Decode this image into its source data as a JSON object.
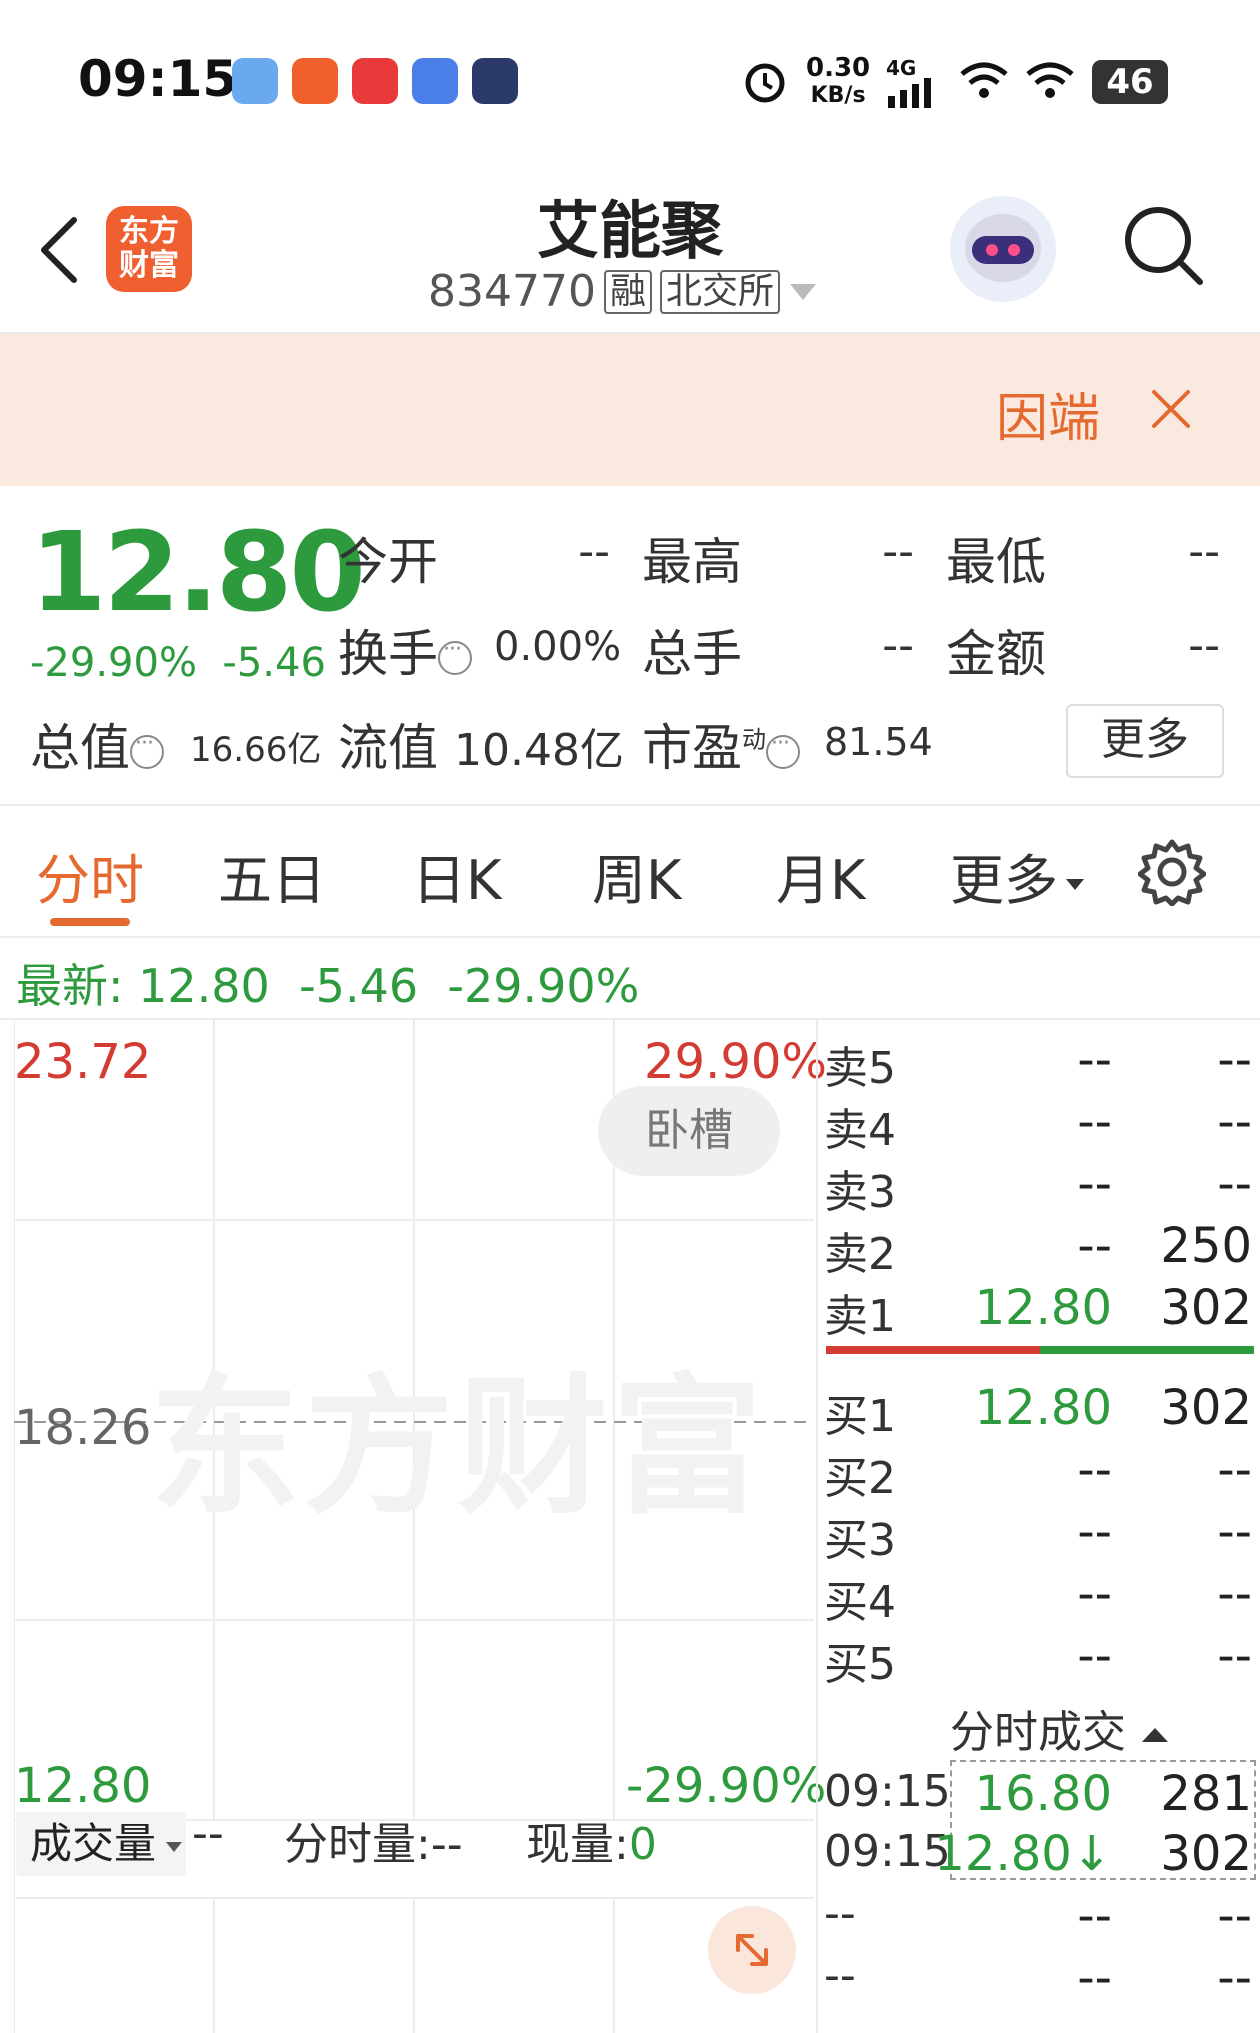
{
  "status_bar": {
    "time": "09:15",
    "net_speed_value": "0.30",
    "net_speed_unit": "KB/s",
    "network_type": "4G",
    "battery": "46",
    "icons": [
      "notes-app-icon",
      "flight-app-icon",
      "music-app-icon",
      "browser-app-icon",
      "video-app-icon",
      "alarm-icon",
      "signal-icon",
      "wifi-plus-icon",
      "wifi-icon",
      "battery-icon"
    ]
  },
  "header": {
    "brand_line1": "东方",
    "brand_line2": "财富",
    "stock_name": "艾能聚",
    "stock_code": "834770",
    "tag_margin": "融",
    "tag_exchange": "北交所"
  },
  "banner": {
    "text": "因端"
  },
  "quote": {
    "price": "12.80",
    "change_pct": "-29.90%",
    "change_amt": "-5.46",
    "open_label": "今开",
    "open_val": "--",
    "high_label": "最高",
    "high_val": "--",
    "low_label": "最低",
    "low_val": "--",
    "turnover_label": "换手",
    "turnover_val": "0.00%",
    "total_lots_label": "总手",
    "total_lots_val": "--",
    "amount_label": "金额",
    "amount_val": "--",
    "market_cap_label": "总值",
    "market_cap_val": "16.66亿",
    "float_cap_label": "流值",
    "float_cap_val": "10.48亿",
    "pe_label": "市盈",
    "pe_superscript": "动",
    "pe_val": "81.54",
    "more_label": "更多"
  },
  "tabs": [
    {
      "label": "分时",
      "active": true
    },
    {
      "label": "五日"
    },
    {
      "label": "日K"
    },
    {
      "label": "周K"
    },
    {
      "label": "月K"
    },
    {
      "label": "更多"
    }
  ],
  "latest": {
    "label": "最新:",
    "price": "12.80",
    "change": "-5.46",
    "pct": "-29.90%"
  },
  "chart": {
    "upper_price": "23.72",
    "upper_pct": "29.90%",
    "mid_price": "18.26",
    "lower_price": "12.80",
    "lower_pct": "-29.90%",
    "lying_label": "卧槽",
    "watermark": "东方财富"
  },
  "volume_bar": {
    "selector_label": "成交量",
    "selector_value": "--",
    "period_vol": "分时量:--",
    "current_vol_label": "现量:",
    "current_vol_value": "0"
  },
  "order_book": {
    "asks": [
      {
        "label": "卖5",
        "price": "--",
        "volume": "--"
      },
      {
        "label": "卖4",
        "price": "--",
        "volume": "--"
      },
      {
        "label": "卖3",
        "price": "--",
        "volume": "--"
      },
      {
        "label": "卖2",
        "price": "--",
        "volume": "250"
      },
      {
        "label": "卖1",
        "price": "12.80",
        "volume": "302"
      }
    ],
    "bids": [
      {
        "label": "买1",
        "price": "12.80",
        "volume": "302"
      },
      {
        "label": "买2",
        "price": "--",
        "volume": "--"
      },
      {
        "label": "买3",
        "price": "--",
        "volume": "--"
      },
      {
        "label": "买4",
        "price": "--",
        "volume": "--"
      },
      {
        "label": "买5",
        "price": "--",
        "volume": "--"
      }
    ]
  },
  "trades": {
    "title": "分时成交",
    "rows": [
      {
        "time": "09:15",
        "price": "16.80",
        "volume": "281"
      },
      {
        "time": "09:15",
        "price": "12.80↓",
        "volume": "302"
      },
      {
        "time": "--",
        "price": "--",
        "volume": "--"
      },
      {
        "time": "--",
        "price": "--",
        "volume": "--"
      }
    ]
  },
  "colors": {
    "up_red": "#d23c32",
    "down_green": "#2e9a3e",
    "accent_orange": "#e46a30",
    "banner_bg": "#fbe9df"
  }
}
